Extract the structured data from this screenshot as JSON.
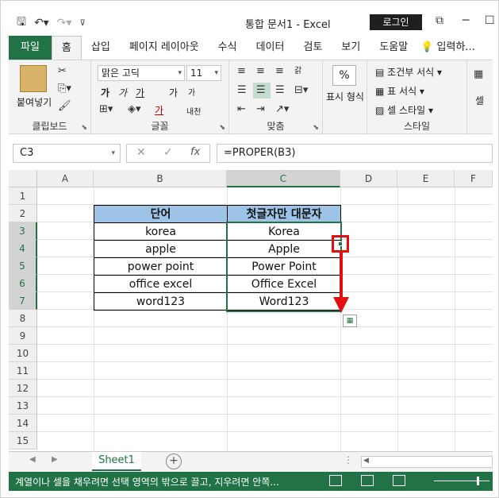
{
  "app": {
    "doc_title": "통합 문서1 - Excel",
    "login_label": "로그인"
  },
  "qat_icons": [
    "save-icon",
    "undo-icon",
    "redo-icon",
    "customize-icon"
  ],
  "tabs": [
    {
      "label": "파일"
    },
    {
      "label": "홈"
    },
    {
      "label": "삽입"
    },
    {
      "label": "페이지 레이아웃"
    },
    {
      "label": "수식"
    },
    {
      "label": "데이터"
    },
    {
      "label": "검토"
    },
    {
      "label": "보기"
    },
    {
      "label": "도움말"
    },
    {
      "label": "입력하..."
    }
  ],
  "ribbon": {
    "clipboard": {
      "label": "클립보드",
      "paste_label": "붙여넣기"
    },
    "font": {
      "label": "글꼴",
      "font_name": "맑은 고딕",
      "font_size": "11",
      "bold": "가",
      "italic": "가",
      "underline": "가",
      "grow": "가",
      "shrink": "가",
      "font_color": "가",
      "phonetic": "내천"
    },
    "align": {
      "label": "맞춤",
      "wrap": "갉"
    },
    "number": {
      "label": "표시 형식",
      "percent": "%"
    },
    "styles": {
      "label": "스타일",
      "conditional": "조건부 서식",
      "table": "표 서식",
      "cell_style": "셀 스타일"
    },
    "cells": {
      "label": "셀"
    }
  },
  "formula_bar": {
    "name_box": "C3",
    "fx": "fx",
    "formula": "=PROPER(B3)"
  },
  "columns": [
    "A",
    "B",
    "C",
    "D",
    "E",
    "F"
  ],
  "rows": [
    "1",
    "2",
    "3",
    "4",
    "5",
    "6",
    "7",
    "8",
    "9",
    "10",
    "11",
    "12",
    "13",
    "14",
    "15"
  ],
  "table": {
    "header": [
      "단어",
      "첫글자만 대문자"
    ],
    "rows": [
      [
        "korea",
        "Korea"
      ],
      [
        "apple",
        "Apple"
      ],
      [
        "power point",
        "Power Point"
      ],
      [
        "office excel",
        "Office Excel"
      ],
      [
        "word123",
        "Word123"
      ]
    ]
  },
  "sheet": {
    "tab": "Sheet1",
    "add": "+"
  },
  "status": {
    "text": "계열이나 셀을 채우려면 선택 영역의 밖으로 끌고, 지우려면 안쪽..."
  },
  "colors": {
    "excel_green": "#217346",
    "header_fill": "#9dc3e6",
    "annotation_red": "#e01010"
  }
}
